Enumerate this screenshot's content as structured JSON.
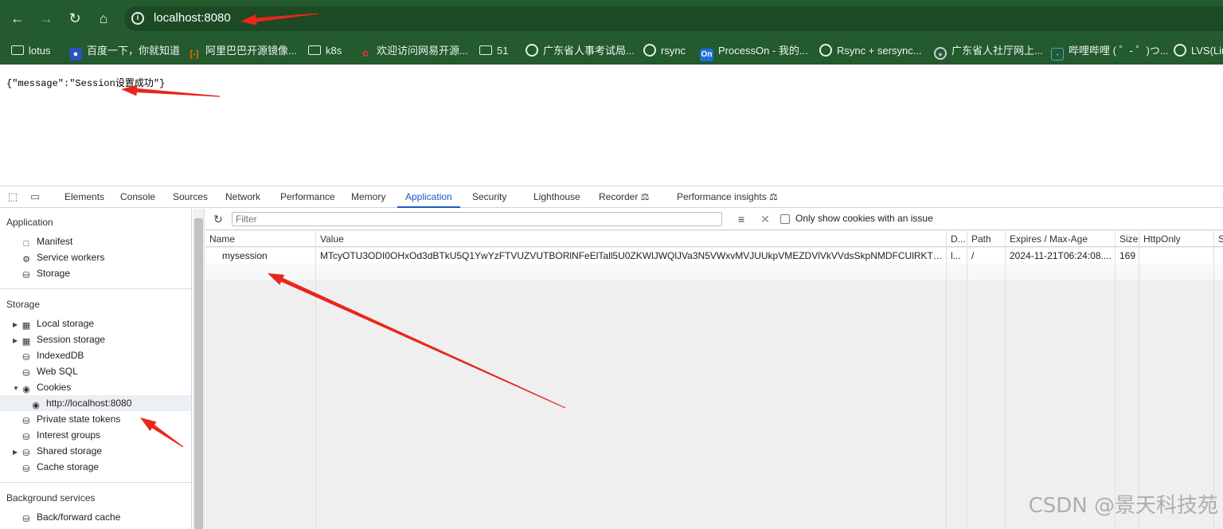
{
  "browser": {
    "url": "localhost:8080",
    "bookmarks": [
      {
        "label": "lotus",
        "icon": "folder-icon"
      },
      {
        "label": "百度一下，你就知道",
        "icon": "baidu-icon"
      },
      {
        "label": "阿里巴巴开源镜像...",
        "icon": "aliyun-icon"
      },
      {
        "label": "k8s",
        "icon": "folder-icon"
      },
      {
        "label": "欢迎访问网易开源...",
        "icon": "netease-icon"
      },
      {
        "label": "51",
        "icon": "folder-icon"
      },
      {
        "label": "广东省人事考试局...",
        "icon": "globe-icon"
      },
      {
        "label": "rsync",
        "icon": "globe-icon"
      },
      {
        "label": "ProcessOn - 我的...",
        "icon": "processon-icon"
      },
      {
        "label": "Rsync + sersync...",
        "icon": "globe-icon"
      },
      {
        "label": "广东省人社厅网上...",
        "icon": "gov-icon"
      },
      {
        "label": "哔哩哔哩 ( ゜- ゜)つ...",
        "icon": "bilibili-icon"
      },
      {
        "label": "LVS(Lin",
        "icon": "globe-icon"
      }
    ]
  },
  "page": {
    "body_text": "{\"message\":\"Session设置成功\"}"
  },
  "devtools": {
    "tabs": [
      "Elements",
      "Console",
      "Sources",
      "Network",
      "Performance",
      "Memory",
      "Application",
      "Security",
      "Lighthouse",
      "Recorder",
      "Performance insights"
    ],
    "active_tab": "Application",
    "sidebar": {
      "application_header": "Application",
      "application_items": [
        "Manifest",
        "Service workers",
        "Storage"
      ],
      "storage_header": "Storage",
      "storage_items": [
        "Local storage",
        "Session storage",
        "IndexedDB",
        "Web SQL",
        "Cookies",
        "http://localhost:8080",
        "Private state tokens",
        "Interest groups",
        "Shared storage",
        "Cache storage"
      ],
      "background_header": "Background services",
      "background_items": [
        "Back/forward cache"
      ]
    },
    "toolbar": {
      "filter_placeholder": "Filter",
      "only_issues_label": "Only show cookies with an issue"
    },
    "table": {
      "columns": [
        "Name",
        "Value",
        "D...",
        "Path",
        "Expires / Max-Age",
        "Size",
        "HttpOnly",
        "S"
      ],
      "rows": [
        {
          "name": "mysession",
          "value": "MTcyOTU3ODI0OHxOd3dBTkU5Q1YwYzFTVUZVUTBORlNFeElTall5U0ZKWlJWQlJVa3N5VWxvMVJUUkpVMEZDVlVkVVdsSkpNMDFCUlRKTFVraE9OR...",
          "domain": "l...",
          "path": "/",
          "expires": "2024-11-21T06:24:08....",
          "size": "169",
          "httponly": "",
          "secure": ""
        }
      ]
    }
  },
  "watermark": "CSDN @景天科技苑",
  "annotation_color": "#e8261c"
}
